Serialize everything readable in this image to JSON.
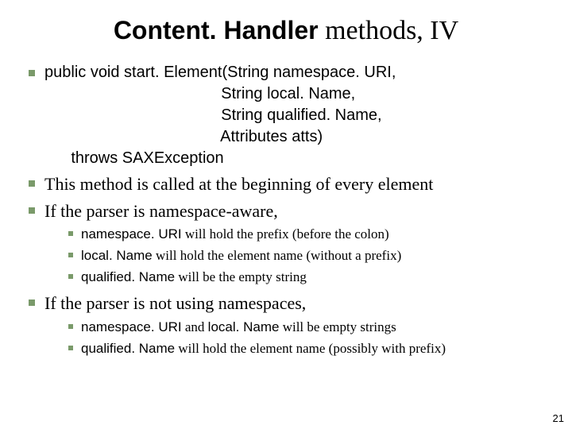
{
  "title_code": "Content. Handler",
  "title_rest": " methods, IV",
  "b1": {
    "l1": "public void start. Element(String namespace. URI,",
    "l2": "                                        String local. Name,",
    "l3": "                                        String qualified. Name,",
    "l4": "                                        Attributes atts)",
    "l5": "      throws SAXException"
  },
  "b2": "This method is called at the beginning of every element",
  "b3": "If the parser is namespace-aware,",
  "b3_sub": {
    "a_code": "namespace. URI",
    "a_rest": " will hold the prefix (before the colon)",
    "b_code": "local. Name",
    "b_rest": " will hold the element name (without a prefix)",
    "c_code": "qualified. Name",
    "c_rest": " will be the empty string"
  },
  "b4": "If the parser is not using namespaces,",
  "b4_sub": {
    "a_code1": "namespace. URI",
    "a_mid": " and ",
    "a_code2": "local. Name",
    "a_rest": " will be empty strings",
    "b_code": "qualified. Name",
    "b_rest": " will hold the element name (possibly with prefix)"
  },
  "page": "21"
}
